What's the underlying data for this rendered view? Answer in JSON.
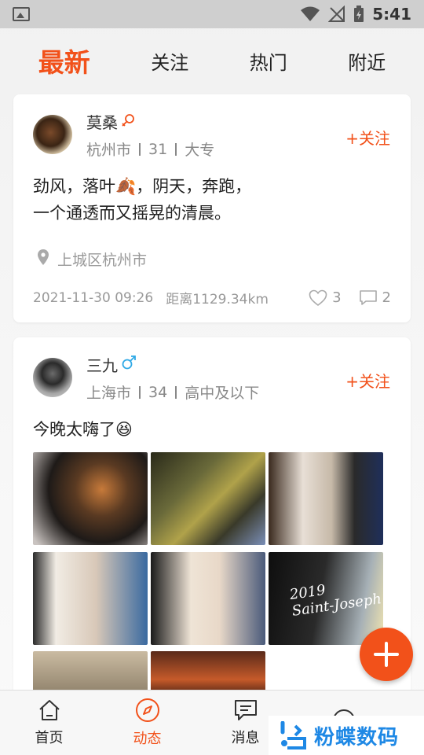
{
  "status_bar": {
    "time": "5:41"
  },
  "tabs": [
    {
      "label": "最新",
      "active": true
    },
    {
      "label": "关注",
      "active": false
    },
    {
      "label": "热门",
      "active": false
    },
    {
      "label": "附近",
      "active": false
    }
  ],
  "posts": [
    {
      "username": "莫桑",
      "gender_icon": "female-icon",
      "city": "杭州市",
      "age": "31",
      "education": "大专",
      "follow_label": "+关注",
      "content_line1": "劲风，落叶🍂，阴天，奔跑，",
      "content_line2": "一个通透而又摇晃的清晨。",
      "location": "上城区杭州市",
      "time": "2021-11-30 09:26",
      "distance": "距离1129.34km",
      "likes": "3",
      "comments": "2"
    },
    {
      "username": "三九",
      "gender_icon": "male-icon",
      "city": "上海市",
      "age": "34",
      "education": "高中及以下",
      "follow_label": "+关注",
      "content": "今晚太嗨了😆",
      "photo_labels": {
        "wine_year": "2019",
        "wine_name": "Saint-Joseph"
      }
    }
  ],
  "bottom_nav": [
    {
      "label": "首页",
      "active": false
    },
    {
      "label": "动态",
      "active": true
    },
    {
      "label": "消息",
      "active": false
    },
    {
      "label": "",
      "active": false
    }
  ],
  "watermark": {
    "text": "粉蝶数码"
  },
  "colors": {
    "accent": "#f2511a",
    "male": "#2fa9e6",
    "watermark": "#1e88e5"
  }
}
